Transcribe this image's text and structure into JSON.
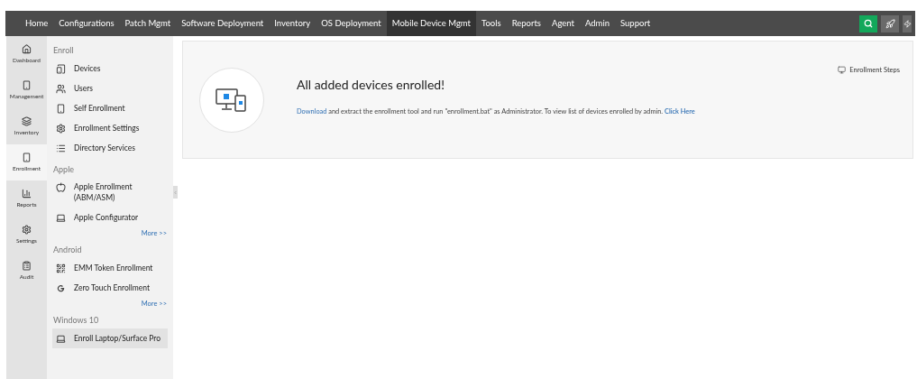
{
  "nav": [
    {
      "label": "Home",
      "selected": false
    },
    {
      "label": "Configurations",
      "selected": false
    },
    {
      "label": "Patch Mgmt",
      "selected": false
    },
    {
      "label": "Software Deployment",
      "selected": false
    },
    {
      "label": "Inventory",
      "selected": false
    },
    {
      "label": "OS Deployment",
      "selected": false
    },
    {
      "label": "Mobile Device Mgmt",
      "selected": true
    },
    {
      "label": "Tools",
      "selected": false
    },
    {
      "label": "Reports",
      "selected": false
    },
    {
      "label": "Agent",
      "selected": false
    },
    {
      "label": "Admin",
      "selected": false
    },
    {
      "label": "Support",
      "selected": false
    }
  ],
  "rail": [
    {
      "label": "Dashboard",
      "selected": false
    },
    {
      "label": "Management",
      "selected": false
    },
    {
      "label": "Inventory",
      "selected": false
    },
    {
      "label": "Enrollment",
      "selected": true
    },
    {
      "label": "Reports",
      "selected": false
    },
    {
      "label": "Settings",
      "selected": false
    },
    {
      "label": "Audit",
      "selected": false
    }
  ],
  "sections": [
    {
      "title": "Enroll",
      "items": [
        {
          "label": "Devices",
          "selected": false
        },
        {
          "label": "Users",
          "selected": false
        },
        {
          "label": "Self Enrollment",
          "selected": false
        },
        {
          "label": "Enrollment Settings",
          "selected": false
        },
        {
          "label": "Directory Services",
          "selected": false
        }
      ]
    },
    {
      "title": "Apple",
      "items": [
        {
          "label": "Apple Enrollment (ABM/ASM)",
          "selected": false
        },
        {
          "label": "Apple Configurator",
          "selected": false
        }
      ],
      "more": "More >>"
    },
    {
      "title": "Android",
      "items": [
        {
          "label": "EMM Token Enrollment",
          "selected": false
        },
        {
          "label": "Zero Touch Enrollment",
          "selected": false
        }
      ],
      "more": "More >>"
    },
    {
      "title": "Windows 10",
      "items": [
        {
          "label": "Enroll Laptop/Surface Pro",
          "selected": true
        }
      ]
    }
  ],
  "card": {
    "steps_link": "Enrollment Steps",
    "heading": "All added devices enrolled!",
    "link_1": "Download",
    "text": " and extract the enrollment tool and run \"enrollment.bat\" as Administrator. To view list of devices enrolled by admin. ",
    "link_2": "Click Here"
  }
}
